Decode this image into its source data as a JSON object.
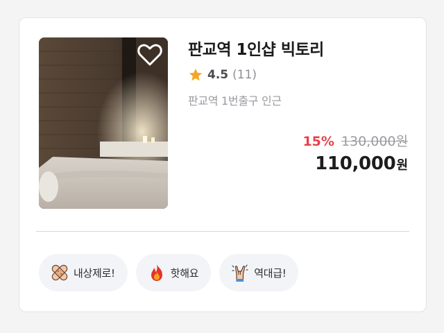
{
  "listing": {
    "title": "판교역 1인샵 빅토리",
    "rating": "4.5",
    "review_count": "(11)",
    "location": "판교역 1번출구 인근",
    "discount": "15%",
    "original_price": "130,000원",
    "final_price": "110,000",
    "currency": "원",
    "favorite_icon": "heart-outline-icon",
    "rating_icon": "star-icon",
    "colors": {
      "discount": "#e8414b",
      "star": "#f5a623",
      "title": "#1c1c1e",
      "muted": "#9a9aa0",
      "tag_bg": "#f3f4f7"
    }
  },
  "tags": [
    {
      "label": "내상제로!",
      "icon": "bandage-icon"
    },
    {
      "label": "핫해요",
      "icon": "fire-icon"
    },
    {
      "label": "역대급!",
      "icon": "rock-hand-icon"
    }
  ]
}
